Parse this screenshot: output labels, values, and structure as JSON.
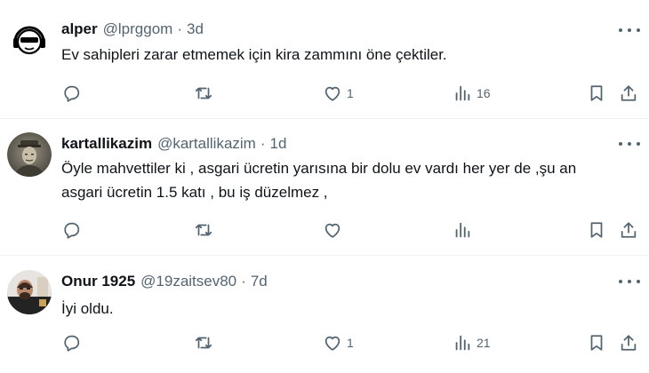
{
  "tweets": [
    {
      "name": "alper",
      "handle": "@lprggom",
      "separator": "·",
      "time": "3d",
      "text": "Ev sahipleri zarar etmemek için kira zammını öne çektiler.",
      "counts": {
        "reply": "",
        "retweet": "",
        "like": "1",
        "views": "16"
      },
      "avatar_icon": "cartoon-headphones-avatar"
    },
    {
      "name": "kartallikazim",
      "handle": "@kartallikazim",
      "separator": "·",
      "time": "1d",
      "text": "Öyle mahvettiler ki , asgari ücretin yarısına bir dolu ev vardı her yer de ,şu an\nasgari ücretin 1.5 katı , bu iş düzelmez ,",
      "counts": {
        "reply": "",
        "retweet": "",
        "like": "",
        "views": ""
      },
      "avatar_icon": "vintage-portrait-avatar"
    },
    {
      "name": "Onur 1925",
      "handle": "@19zaitsev80",
      "separator": "·",
      "time": "7d",
      "text": "İyi oldu.",
      "counts": {
        "reply": "",
        "retweet": "",
        "like": "1",
        "views": "21"
      },
      "avatar_icon": "photo-avatar"
    }
  ],
  "icons": [
    "reply-icon",
    "retweet-icon",
    "like-icon",
    "views-icon",
    "bookmark-icon",
    "share-icon",
    "more-icon"
  ],
  "colors": {
    "text": "#0f1419",
    "secondary": "#536471",
    "divider": "#eff3f4"
  }
}
